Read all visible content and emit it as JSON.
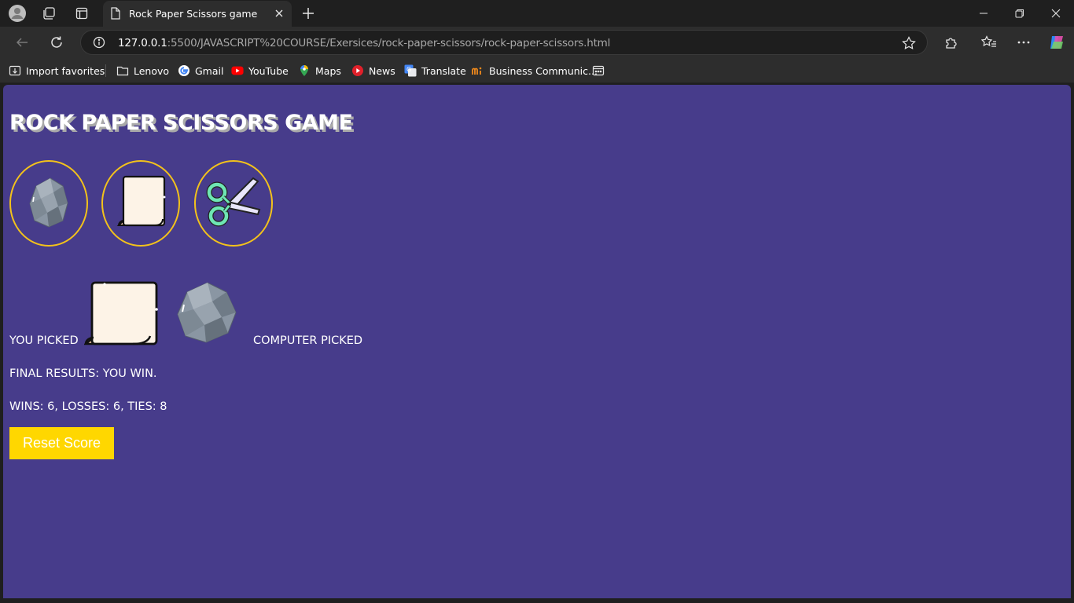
{
  "browser": {
    "tab_title": "Rock Paper Scissors game",
    "url_host": "127.0.0.1",
    "url_rest": ":5500/JAVASCRIPT%20COURSE/Exersices/rock-paper-scissors/rock-paper-scissors.html",
    "bookmarks": [
      {
        "label": "Import favorites",
        "icon": "import-icon"
      },
      {
        "label": "Lenovo",
        "icon": "folder-icon"
      },
      {
        "label": "Gmail",
        "icon": "google-icon"
      },
      {
        "label": "YouTube",
        "icon": "youtube-icon"
      },
      {
        "label": "Maps",
        "icon": "maps-icon"
      },
      {
        "label": "News",
        "icon": "news-icon"
      },
      {
        "label": "Translate",
        "icon": "translate-icon"
      },
      {
        "label": "Business Communic...",
        "icon": "business-icon"
      }
    ]
  },
  "game": {
    "title": "ROCK PAPER SCISSORS GAME",
    "moves": [
      {
        "name": "rock",
        "icon": "rock-icon"
      },
      {
        "name": "paper",
        "icon": "paper-icon"
      },
      {
        "name": "scissors",
        "icon": "scissors-icon"
      }
    ],
    "you_picked_label": "YOU PICKED",
    "you_picked": "paper",
    "computer_picked": "rock",
    "computer_picked_label": "COMPUTER PICKED",
    "final_result": "FINAL RESULTS: YOU WIN.",
    "score": "WINS: 6, LOSSES: 6, TIES: 8",
    "reset_label": "Reset Score"
  },
  "colors": {
    "page_bg": "#473c8b",
    "button_border": "#f3c21b",
    "reset_bg": "#ffd700"
  }
}
